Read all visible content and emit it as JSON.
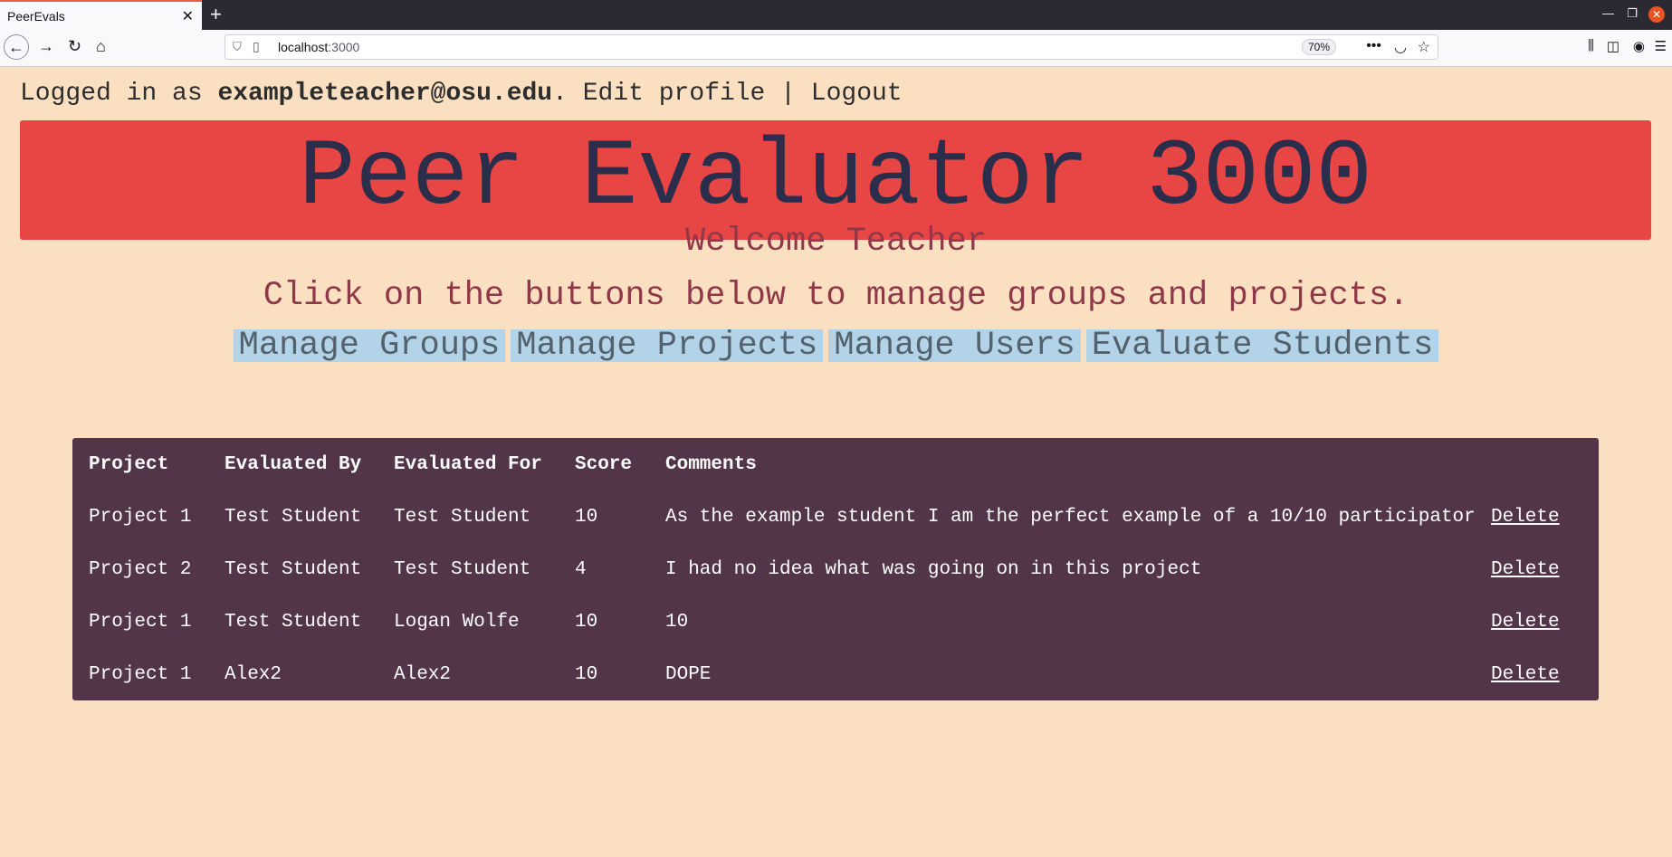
{
  "browser": {
    "tab_title": "PeerEvals",
    "url_host": "localhost",
    "url_port": ":3000",
    "zoom": "70%"
  },
  "header": {
    "logged_in_prefix": "Logged in as ",
    "user_email": "exampleteacher@osu.edu",
    "period": ". ",
    "edit_profile": "Edit profile",
    "separator": " | ",
    "logout": "Logout"
  },
  "banner": {
    "title": "Peer Evaluator 3000"
  },
  "welcome": "Welcome Teacher",
  "instructions": "Click on the buttons below to manage groups and projects.",
  "nav_buttons": {
    "groups": "Manage Groups",
    "projects": "Manage Projects",
    "users": "Manage Users",
    "evaluate": "Evaluate Students"
  },
  "table": {
    "headers": [
      "Project",
      "Evaluated By",
      "Evaluated For",
      "Score",
      "Comments"
    ],
    "delete_label": "Delete",
    "rows": [
      [
        "Project 1",
        "Test Student",
        "Test Student",
        "10",
        "As the example student I am the perfect example of a 10/10 participator"
      ],
      [
        "Project 2",
        "Test Student",
        "Test Student",
        "4",
        "I had no idea what was going on in this project"
      ],
      [
        "Project 1",
        "Test Student",
        "Logan Wolfe",
        "10",
        "10"
      ],
      [
        "Project 1",
        "Alex2",
        "Alex2",
        "10",
        "DOPE"
      ]
    ]
  }
}
